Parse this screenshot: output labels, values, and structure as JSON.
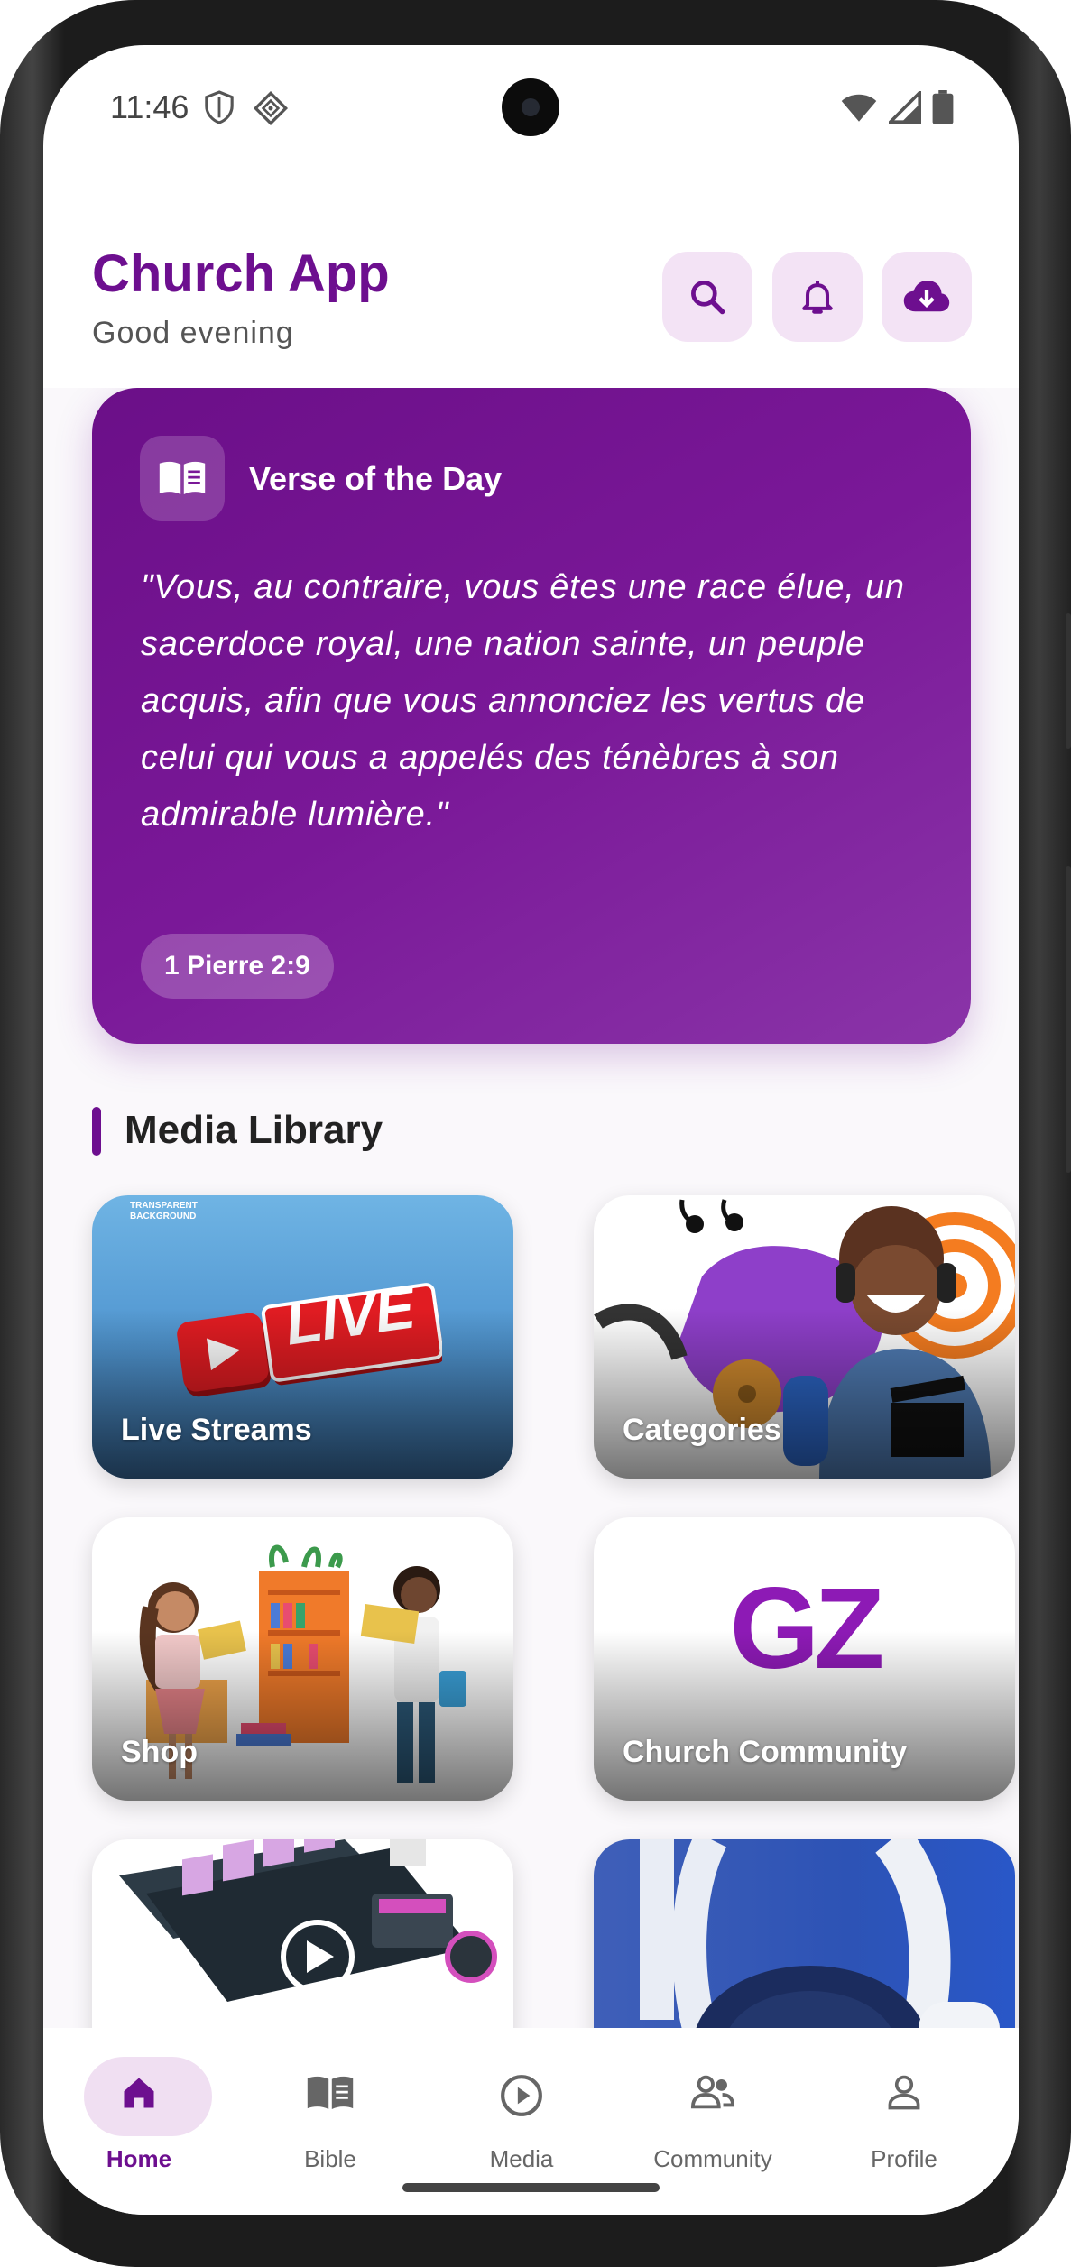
{
  "status_bar": {
    "time": "11:46"
  },
  "header": {
    "title": "Church App",
    "subtitle": "Good evening"
  },
  "verse": {
    "heading": "Verse of the Day",
    "text": "\"Vous, au contraire, vous êtes une race élue, un sacerdoce royal, une nation sainte, un peuple acquis, afin que vous annonciez les vertus de celui qui vous a appelés des ténèbres à son admirable lumière.\"",
    "reference": "1 Pierre 2:9"
  },
  "media_library": {
    "title": "Media Library",
    "tiles": [
      {
        "label": "Live Streams",
        "image_text": "LIVE",
        "watermark": "TRANSPARENT BACKGROUND"
      },
      {
        "label": "Categories"
      },
      {
        "label": "Shop"
      },
      {
        "label": "Church Community",
        "logo_text": "GZ"
      },
      {
        "label": ""
      },
      {
        "label": ""
      }
    ]
  },
  "bottom_nav": {
    "items": [
      {
        "label": "Home",
        "icon": "home-icon",
        "active": true
      },
      {
        "label": "Bible",
        "icon": "book-icon"
      },
      {
        "label": "Media",
        "icon": "play-circle-icon"
      },
      {
        "label": "Community",
        "icon": "people-icon"
      },
      {
        "label": "Profile",
        "icon": "person-icon"
      }
    ]
  },
  "colors": {
    "brand": "#6d0f8f",
    "accent_light": "#f3e3f5"
  }
}
